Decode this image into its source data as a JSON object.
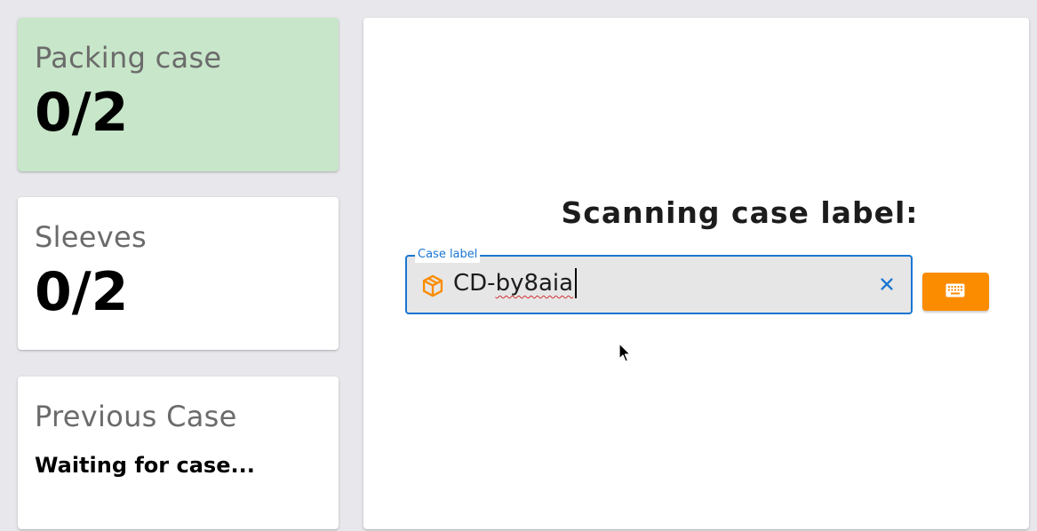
{
  "packing_case": {
    "title": "Packing case",
    "value": "0/2",
    "color": "#c8e6c9"
  },
  "sleeves": {
    "title": "Sleeves",
    "value": "0/2"
  },
  "previous_case": {
    "title": "Previous Case",
    "status": "Waiting for case..."
  },
  "scan": {
    "heading": "Scanning case label:",
    "field_label": "Case label",
    "value_prefix": "CD-",
    "value_rest": "by8aia",
    "icon": "package-icon",
    "clear_icon": "close-icon",
    "keyboard_icon": "keyboard-icon",
    "accent_color": "#1976d2",
    "button_color": "#fb8c00"
  }
}
